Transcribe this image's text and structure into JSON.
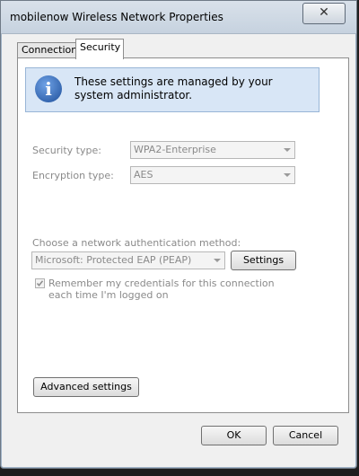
{
  "window": {
    "title": "mobilenow Wireless Network Properties",
    "close_glyph": "✕"
  },
  "tabs": [
    {
      "label": "Connection"
    },
    {
      "label": "Security"
    }
  ],
  "info": {
    "icon": "info-icon",
    "icon_glyph": "i",
    "text": "These settings are managed by your system administrator."
  },
  "security_type": {
    "label": "Security type:",
    "value": "WPA2-Enterprise"
  },
  "encryption_type": {
    "label": "Encryption type:",
    "value": "AES"
  },
  "auth": {
    "label": "Choose a network authentication method:",
    "value": "Microsoft: Protected EAP (PEAP)",
    "settings_button": "Settings"
  },
  "remember": {
    "label": "Remember my credentials for this connection each time I'm logged on",
    "checked": true
  },
  "advanced_button": "Advanced settings",
  "footer": {
    "ok": "OK",
    "cancel": "Cancel"
  }
}
